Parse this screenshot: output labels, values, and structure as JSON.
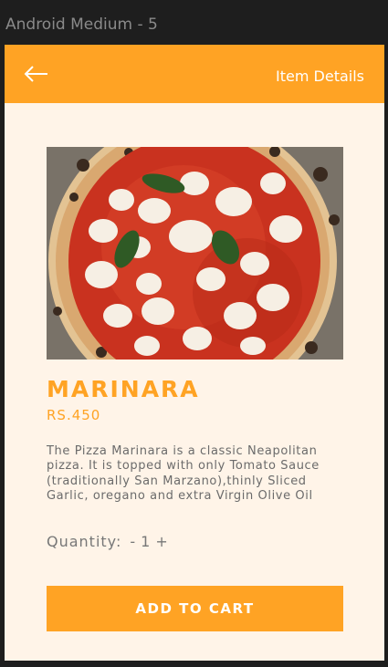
{
  "frame": {
    "label": "Android Medium - 5"
  },
  "appbar": {
    "back_icon": "arrow-left-icon",
    "title": "Item Details"
  },
  "item": {
    "image_alt": "Marinara pizza",
    "name": "MARINARA",
    "price": "RS.450",
    "description": "The Pizza Marinara is a classic Neapolitan pizza. It is topped with only Tomato Sauce (traditionally San Marzano),thinly Sliced Garlic, oregano and extra Virgin Olive Oil"
  },
  "quantity": {
    "label": "Quantity:",
    "minus": "-",
    "value": "1",
    "plus": "+"
  },
  "cart": {
    "button_label": "ADD TO CART"
  },
  "colors": {
    "accent": "#ffa324",
    "background": "#fff4e8",
    "frame": "#1e1e1e"
  }
}
